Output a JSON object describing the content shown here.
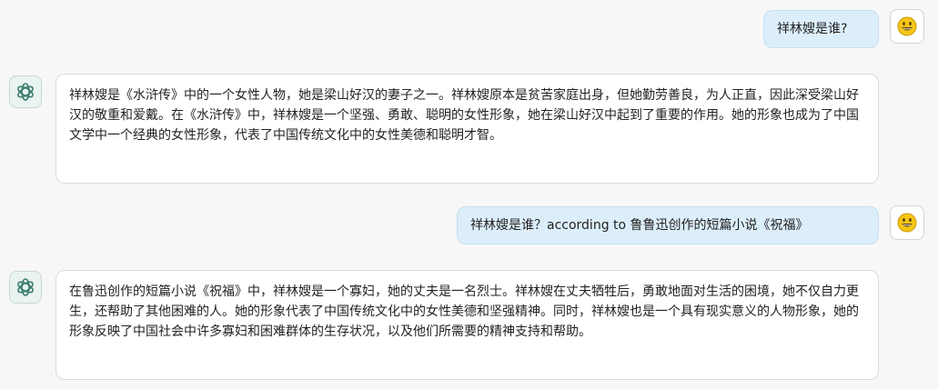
{
  "conversation": {
    "messages": [
      {
        "role": "user",
        "text": "祥林嫂是谁?",
        "avatar_icon": "smiley-face-icon"
      },
      {
        "role": "assistant",
        "text": "祥林嫂是《水浒传》中的一个女性人物，她是梁山好汉的妻子之一。祥林嫂原本是贫苦家庭出身，但她勤劳善良，为人正直，因此深受梁山好汉的敬重和爱戴。在《水浒传》中，祥林嫂是一个坚强、勇敢、聪明的女性形象，她在梁山好汉中起到了重要的作用。她的形象也成为了中国文学中一个经典的女性形象，代表了中国传统文化中的女性美德和聪明才智。",
        "avatar_icon": "openai-logo-icon"
      },
      {
        "role": "user",
        "text": "祥林嫂是谁？according to 鲁鲁迅创作的短篇小说《祝福》",
        "avatar_icon": "smiley-face-icon"
      },
      {
        "role": "assistant",
        "text": "在鲁迅创作的短篇小说《祝福》中，祥林嫂是一个寡妇，她的丈夫是一名烈士。祥林嫂在丈夫牺牲后，勇敢地面对生活的困境，她不仅自力更生，还帮助了其他困难的人。她的形象代表了中国传统文化中的女性美德和坚强精神。同时，祥林嫂也是一个具有现实意义的人物形象，她的形象反映了中国社会中许多寡妇和困难群体的生存状况，以及他们所需要的精神支持和帮助。",
        "avatar_icon": "openai-logo-icon"
      }
    ]
  },
  "colors": {
    "background": "#f7f7f8",
    "user_bubble": "#dceefa",
    "assistant_bubble": "#ffffff",
    "assistant_icon": "#3b7d6e",
    "smiley": "#f5c518"
  }
}
